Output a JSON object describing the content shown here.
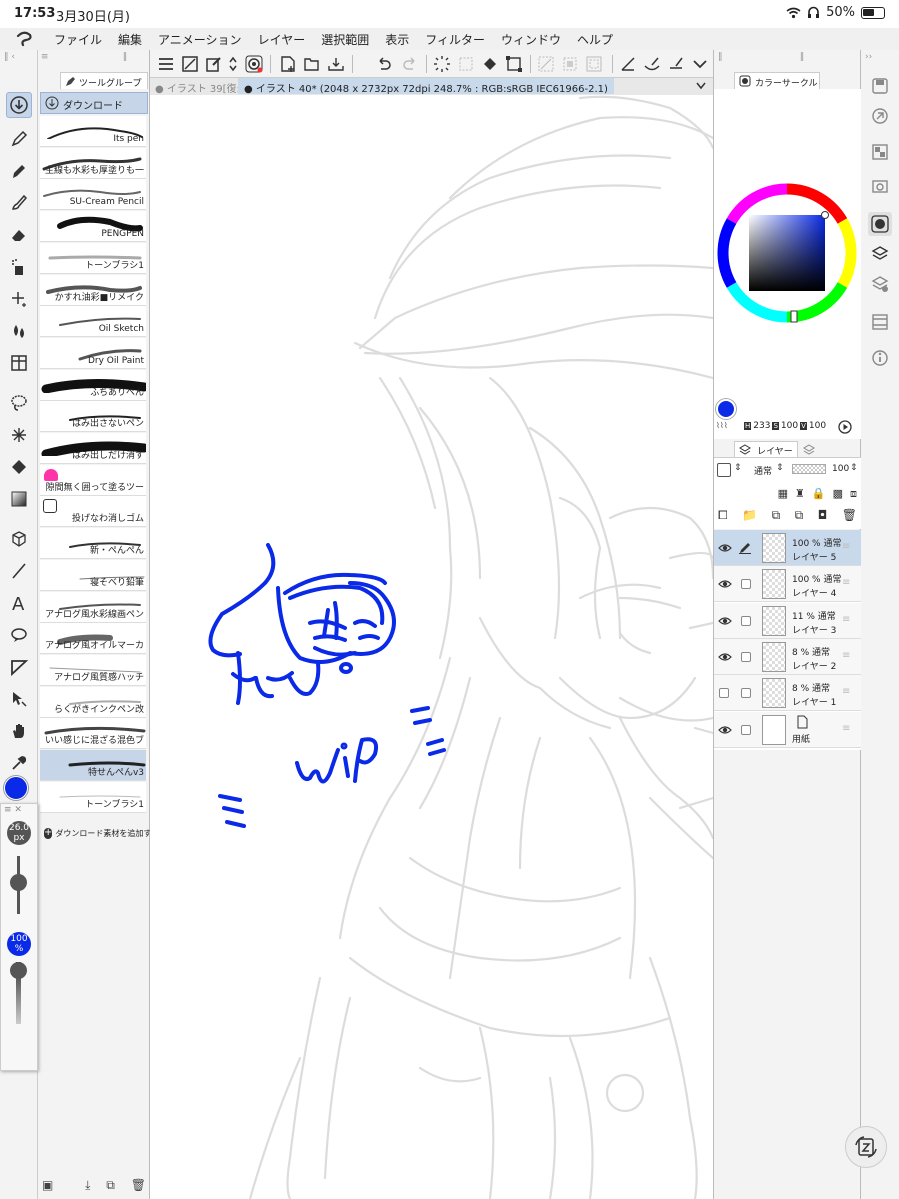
{
  "status": {
    "time": "17:53",
    "date": "3月30日(月)",
    "battery": "50%"
  },
  "menu": [
    "ファイル",
    "編集",
    "アニメーション",
    "レイヤー",
    "選択範囲",
    "表示",
    "フィルター",
    "ウィンドウ",
    "ヘルプ"
  ],
  "subtool": {
    "group_tab": "ツールグループ",
    "group_name": "ダウンロード",
    "add_material": "ダウンロード素材を追加す"
  },
  "brushes": [
    "Its pen",
    "主線も水彩も厚塗りも一",
    "SU-Cream Pencil",
    "PENGPEN",
    "トーンブラシ1",
    "かすれ油彩■リメイク",
    "Oil Sketch",
    "Dry Oil Paint",
    "ふちありぺん",
    "はみ出さないペン",
    "はみ出しだけ消す",
    "隙間無く囲って塗るツー",
    "投げなわ消しゴム",
    "新・ぺんぺん",
    "寝そべり鉛筆",
    "アナログ風水彩線画ペン",
    "アナログ風オイルマーカ",
    "アナログ風質感ハッチ",
    "らくがきインクペン改",
    "いい感じに混ざる混色ブ",
    "特せんぺんv3",
    "トーンブラシ1"
  ],
  "tabs": {
    "inactive": "● イラスト 39[復:",
    "active": "● イラスト 40* (2048 x 2732px 72dpi 248.7% : RGB:sRGB IEC61966-2.1)"
  },
  "color": {
    "panel_title": "カラーサークル",
    "h": "233",
    "s": "100",
    "v": "100",
    "current": "#0a2ae8"
  },
  "layers": {
    "panel_title": "レイヤー",
    "blend": "通常",
    "opacity": "100",
    "items": [
      {
        "pct": "100 %",
        "mode": "通常",
        "name": "レイヤー 5",
        "visible": true,
        "selected": true
      },
      {
        "pct": "100 %",
        "mode": "通常",
        "name": "レイヤー 4",
        "visible": true,
        "selected": false
      },
      {
        "pct": "11 %",
        "mode": "通常",
        "name": "レイヤー 3",
        "visible": true,
        "selected": false
      },
      {
        "pct": "8 %",
        "mode": "通常",
        "name": "レイヤー 2",
        "visible": true,
        "selected": false
      },
      {
        "pct": "8 %",
        "mode": "通常",
        "name": "レイヤー 1",
        "visible": false,
        "selected": false
      },
      {
        "pct": "",
        "mode": "",
        "name": "用紙",
        "visible": true,
        "selected": false
      }
    ]
  },
  "brush_size": {
    "value": "26.0",
    "unit": "px"
  },
  "brush_opacity": {
    "value": "100",
    "unit": "%"
  },
  "canvas_text": "WiP"
}
